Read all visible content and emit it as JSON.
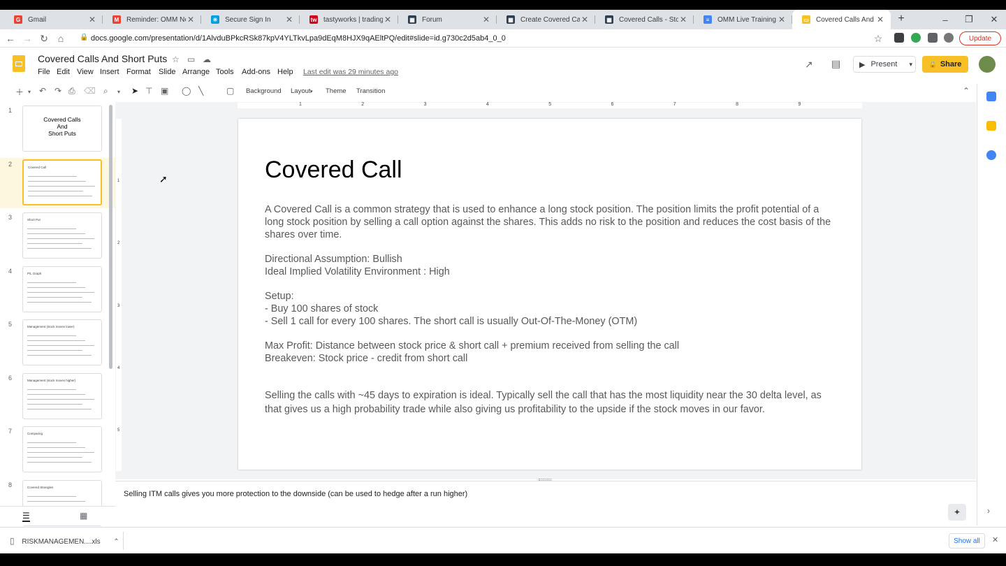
{
  "browser": {
    "tabs": [
      {
        "title": "Gmail",
        "favicon_text": "G",
        "color": "#ea4335"
      },
      {
        "title": "Reminder: OMM New ...",
        "favicon_text": "M",
        "color": "#ea4335"
      },
      {
        "title": "Secure Sign In",
        "favicon_text": "✳",
        "color": "#00a1e0"
      },
      {
        "title": "tastyworks | trading",
        "favicon_text": "tw",
        "color": "#d0021b"
      },
      {
        "title": "Forum",
        "favicon_text": "▦",
        "color": "#2c3e50"
      },
      {
        "title": "Create Covered Call",
        "favicon_text": "▦",
        "color": "#2c3e50"
      },
      {
        "title": "Covered Calls - Stock ...",
        "favicon_text": "▦",
        "color": "#2c3e50"
      },
      {
        "title": "OMM Live Training - F...",
        "favicon_text": "≡",
        "color": "#4285f4"
      },
      {
        "title": "Covered Calls And Sho...",
        "favicon_text": "▭",
        "color": "#f6c026"
      }
    ],
    "url": "docs.google.com/presentation/d/1AlvduBPkcRSk87kpV4YLTkvLpa9dEqM8HJX9qAEltPQ/edit#slide=id.g730c2d5ab4_0_0",
    "update_label": "Update"
  },
  "doc": {
    "title": "Covered Calls And Short Puts",
    "menus": [
      "File",
      "Edit",
      "View",
      "Insert",
      "Format",
      "Slide",
      "Arrange",
      "Tools",
      "Add-ons",
      "Help"
    ],
    "last_edit": "Last edit was 29 minutes ago",
    "present_label": "Present",
    "share_label": "Share"
  },
  "toolbar": {
    "background_label": "Background",
    "layout_label": "Layout",
    "theme_label": "Theme",
    "transition_label": "Transition"
  },
  "filmstrip": {
    "selected": 2,
    "slides": [
      {
        "num": "1",
        "title": "Covered Calls\nAnd\nShort Puts"
      },
      {
        "num": "2",
        "title": "Covered Call"
      },
      {
        "num": "3",
        "title": "Short Put"
      },
      {
        "num": "4",
        "title": "P/L Graph"
      },
      {
        "num": "5",
        "title": "Management (stock moves lower)"
      },
      {
        "num": "6",
        "title": "Management (stock moves higher)"
      },
      {
        "num": "7",
        "title": "Comparing"
      },
      {
        "num": "8",
        "title": "Covered Strangles"
      }
    ]
  },
  "ruler": {
    "h_marks": [
      "1",
      "2",
      "3",
      "4",
      "5",
      "6",
      "7",
      "8",
      "9"
    ],
    "v_marks": [
      "1",
      "2",
      "3",
      "4",
      "5"
    ]
  },
  "slide": {
    "title": "Covered Call",
    "intro": "A Covered Call is a common strategy that is used to enhance a long stock position. The position limits the profit potential of a long stock position by selling a call option against the shares. This adds no risk to the position and reduces the cost basis of the shares over time.",
    "direction": "Directional Assumption: Bullish",
    "iv": "Ideal Implied Volatility Environment : High",
    "setup_label": "Setup:",
    "setup_1": "- Buy 100 shares of stock",
    "setup_2": "- Sell 1 call for every 100 shares. The short call is usually Out-Of-The-Money (OTM)",
    "max_profit": "Max Profit: Distance between stock price & short call + premium received from selling the call",
    "breakeven": "Breakeven: Stock price - credit from short call",
    "footer": "Selling the calls with ~45 days to expiration is ideal. Typically sell the call that has the most liquidity near the 30 delta level, as that gives us a high probability trade while also giving us profitability to the upside if the stock moves in our favor."
  },
  "notes": {
    "text": "Selling ITM calls gives you more protection to the downside (can be used to hedge after a run higher)"
  },
  "downloads": {
    "file": "RISKMANAGEMEN....xls",
    "show_all": "Show all"
  }
}
